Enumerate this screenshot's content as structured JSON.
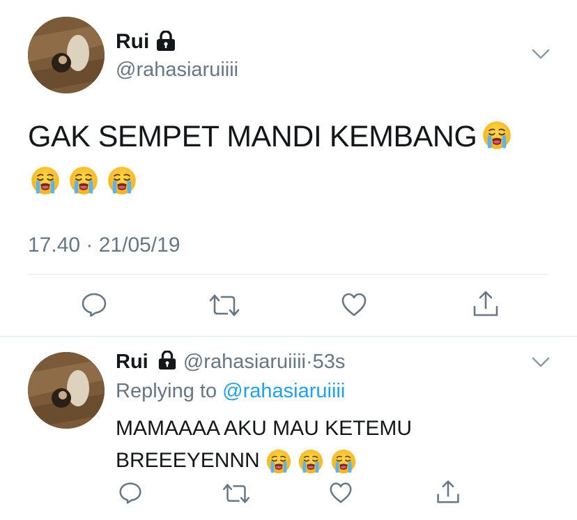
{
  "main_tweet": {
    "name": "Rui",
    "handle": "@rahasiaruiiii",
    "text_line1": "GAK SEMPET MANDI KEMBANG",
    "timestamp": "17.40 · 21/05/19",
    "icons": {
      "lock": "lock-icon",
      "more": "chevron-down-icon",
      "emoji": "loudly-crying-face-emoji",
      "reply": "reply-icon",
      "retweet": "retweet-icon",
      "like": "heart-icon",
      "share": "share-icon"
    }
  },
  "reply_tweet": {
    "name": "Rui",
    "handle": "@rahasiaruiiii",
    "separator": "·",
    "time_ago": "53s",
    "replying_label": "Replying to",
    "replying_to": "@rahasiaruiiii",
    "text_line1": "MAMAAAA AKU MAU KETEMU",
    "text_line2": "BREEEYENNN"
  },
  "colors": {
    "text": "#14171a",
    "muted": "#657786",
    "link": "#1da1f2",
    "divider": "#e1e8ed"
  }
}
